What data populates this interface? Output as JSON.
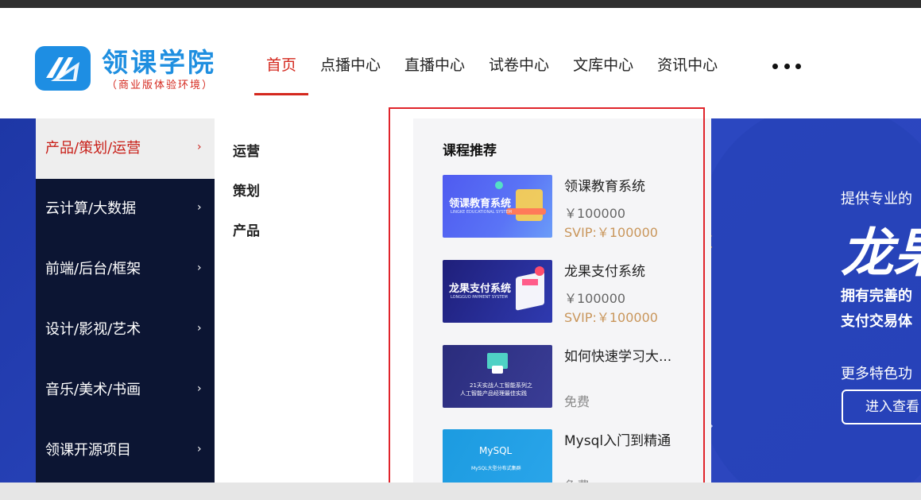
{
  "logo": {
    "title": "领课学院",
    "subtitle": "（商业版体验环境）"
  },
  "nav": {
    "items": [
      {
        "label": "首页",
        "active": true
      },
      {
        "label": "点播中心",
        "active": false
      },
      {
        "label": "直播中心",
        "active": false
      },
      {
        "label": "试卷中心",
        "active": false
      },
      {
        "label": "文库中心",
        "active": false
      },
      {
        "label": "资讯中心",
        "active": false
      }
    ],
    "more_icon": "more-dots-icon"
  },
  "categories": [
    {
      "label": "产品/策划/运营",
      "active": true
    },
    {
      "label": "云计算/大数据",
      "active": false
    },
    {
      "label": "前端/后台/框架",
      "active": false
    },
    {
      "label": "设计/影视/艺术",
      "active": false
    },
    {
      "label": "音乐/美术/书画",
      "active": false
    },
    {
      "label": "领课开源项目",
      "active": false
    }
  ],
  "subcategories": [
    "运营",
    "策划",
    "产品"
  ],
  "recommend": {
    "title": "课程推荐",
    "courses": [
      {
        "name": "领课教育系统",
        "price": "￥100000",
        "svip": "SVIP:￥100000",
        "thumb_title": "领课教育系统",
        "thumb_sub": "LINGKE EDUCATIONAL SYSTEM"
      },
      {
        "name": "龙果支付系统",
        "price": "￥100000",
        "svip": "SVIP:￥100000",
        "thumb_title": "龙果支付系统",
        "thumb_sub": "LONGGUO PAYMENT SYSTEM"
      },
      {
        "name": "如何快速学习大...",
        "free": "免费",
        "thumb_title": "21天实战人工智能系列之",
        "thumb_sub": "人工智能产品经理最佳实践"
      },
      {
        "name": "Mysql入门到精通",
        "free": "免费",
        "thumb_title": "MySQL",
        "thumb_sub": "MySQL大型分布式集群"
      }
    ]
  },
  "banner": {
    "line1": "提供专业的",
    "big": "龙果",
    "line2a": "拥有完善的",
    "line2b": "支付交易体",
    "line3": "更多特色功",
    "button": "进入查看"
  },
  "colors": {
    "accent_red": "#d4281e",
    "menu_dark": "#0c1533",
    "banner_blue": "#2b47c0",
    "svip_gold": "#c9965b"
  }
}
